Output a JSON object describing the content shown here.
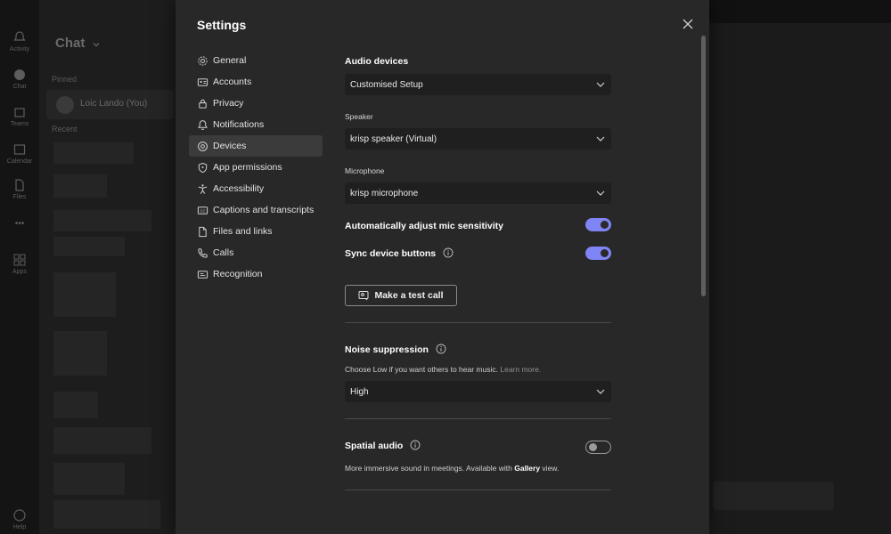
{
  "background": {
    "rail": [
      "Activity",
      "Chat",
      "Teams",
      "Calendar",
      "Files",
      "•••",
      "Apps",
      "Help"
    ],
    "chat_title": "Chat",
    "pinned_label": "Pinned",
    "pinned_name": "Loic Lando (You)",
    "recent_label": "Recent"
  },
  "settings": {
    "title": "Settings",
    "nav": [
      {
        "label": "General",
        "icon": "gear-icon"
      },
      {
        "label": "Accounts",
        "icon": "id-card-icon"
      },
      {
        "label": "Privacy",
        "icon": "lock-icon"
      },
      {
        "label": "Notifications",
        "icon": "bell-icon"
      },
      {
        "label": "Devices",
        "icon": "speaker-icon"
      },
      {
        "label": "App permissions",
        "icon": "shield-icon"
      },
      {
        "label": "Accessibility",
        "icon": "accessibility-icon"
      },
      {
        "label": "Captions and transcripts",
        "icon": "cc-icon"
      },
      {
        "label": "Files and links",
        "icon": "file-icon"
      },
      {
        "label": "Calls",
        "icon": "phone-icon"
      },
      {
        "label": "Recognition",
        "icon": "recognition-icon"
      }
    ],
    "active_nav": "Devices",
    "audio": {
      "heading": "Audio devices",
      "setup_value": "Customised Setup",
      "speaker_label": "Speaker",
      "speaker_value": "krisp speaker (Virtual)",
      "mic_label": "Microphone",
      "mic_value": "krisp microphone",
      "auto_adjust_label": "Automatically adjust mic sensitivity",
      "auto_adjust_on": true,
      "sync_label": "Sync device buttons",
      "sync_on": true,
      "test_call_label": "Make a test call"
    },
    "noise": {
      "heading": "Noise suppression",
      "desc": "Choose Low if you want others to hear music.",
      "learn_more": "Learn more.",
      "value": "High"
    },
    "spatial": {
      "heading": "Spatial audio",
      "on": false,
      "desc_pre": "More immersive sound in meetings. Available with ",
      "desc_bold": "Gallery",
      "desc_post": " view."
    }
  },
  "colors": {
    "accent": "#7f85f5",
    "modal_bg": "#282828",
    "select_bg": "#1f1f1f"
  }
}
